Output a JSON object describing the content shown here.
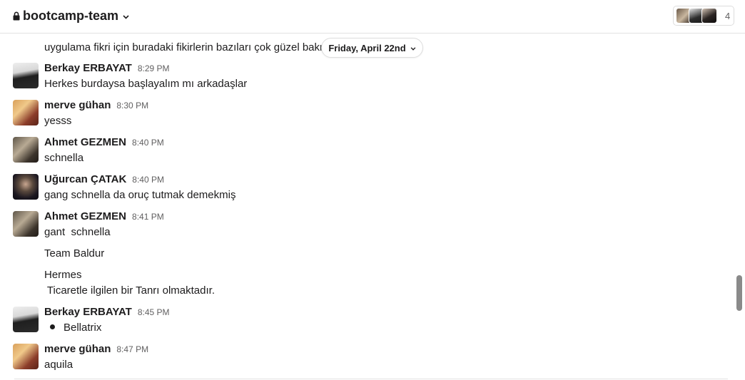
{
  "header": {
    "channel_name": "bootcamp-team",
    "member_count": "4"
  },
  "date_divider": "Friday, April 22nd",
  "partial_message": "uygulama fikri için buradaki fikirlerin bazıları çok güzel bakm",
  "messages": [
    {
      "author": "Berkay ERBAYAT",
      "time": "8:29 PM",
      "lines": [
        "Herkes burdaysa başlayalım mı arkadaşlar"
      ]
    },
    {
      "author": "merve gühan",
      "time": "8:30 PM",
      "lines": [
        "yesss"
      ]
    },
    {
      "author": "Ahmet GEZMEN",
      "time": "8:40 PM",
      "lines": [
        "schnella"
      ]
    },
    {
      "author": "Uğurcan ÇATAK",
      "time": "8:40 PM",
      "lines": [
        "gang schnella da oruç tutmak demekmiş"
      ]
    },
    {
      "author": "Ahmet GEZMEN",
      "time": "8:41 PM",
      "lines": [
        "gant  schnella",
        "Team Baldur",
        "Hermes",
        " Ticaretle ilgilen bir Tanrı olmaktadır."
      ]
    },
    {
      "author": "Berkay ERBAYAT",
      "time": "8:45 PM",
      "lines": [
        "Bellatrix"
      ]
    },
    {
      "author": "merve gühan",
      "time": "8:47 PM",
      "lines": [
        "aquila"
      ]
    }
  ],
  "colors": {
    "text": "#1d1c1d",
    "muted": "#616061",
    "border": "#dddddd"
  }
}
